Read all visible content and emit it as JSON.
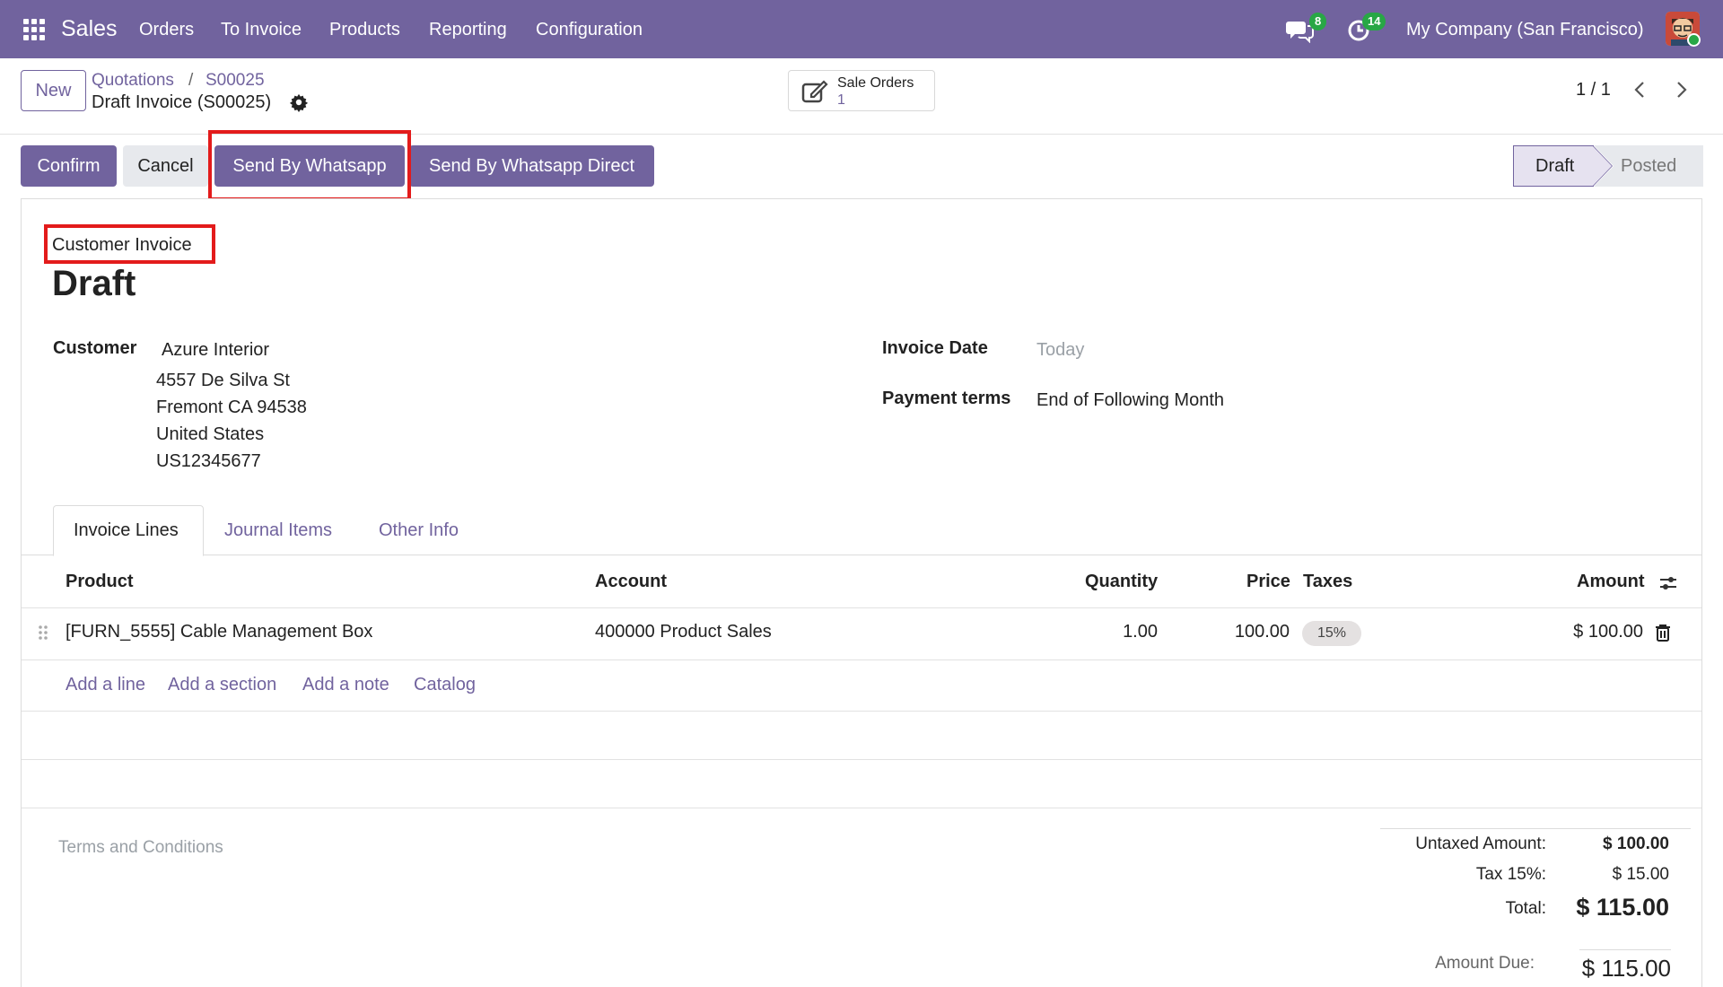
{
  "navbar": {
    "app_name": "Sales",
    "menus": [
      "Orders",
      "To Invoice",
      "Products",
      "Reporting",
      "Configuration"
    ],
    "messages_count": "8",
    "activities_count": "14",
    "company": "My Company (San Francisco)"
  },
  "control_panel": {
    "new_label": "New",
    "breadcrumb_parent": "Quotations",
    "breadcrumb_sep": "/",
    "breadcrumb_order": "S00025",
    "current_record": "Draft Invoice (S00025)",
    "smart_button_label": "Sale Orders",
    "smart_button_value": "1",
    "pager": "1 / 1"
  },
  "actions": {
    "confirm": "Confirm",
    "cancel": "Cancel",
    "send_whatsapp": "Send By Whatsapp",
    "send_whatsapp_direct": "Send By Whatsapp Direct"
  },
  "status": {
    "stages": [
      "Draft",
      "Posted"
    ],
    "current": "Draft"
  },
  "form": {
    "move_type": "Customer Invoice",
    "title": "Draft",
    "customer_label": "Customer",
    "customer_name": "Azure Interior",
    "customer_address": [
      "4557 De Silva St",
      "Fremont CA 94538",
      "United States",
      "US12345677"
    ],
    "invoice_date_label": "Invoice Date",
    "invoice_date_placeholder": "Today",
    "payment_terms_label": "Payment terms",
    "payment_terms_value": "End of Following Month"
  },
  "tabs": [
    "Invoice Lines",
    "Journal Items",
    "Other Info"
  ],
  "lines": {
    "headers": {
      "product": "Product",
      "account": "Account",
      "quantity": "Quantity",
      "price": "Price",
      "taxes": "Taxes",
      "amount": "Amount"
    },
    "rows": [
      {
        "product": "[FURN_5555] Cable Management Box",
        "account": "400000 Product Sales",
        "quantity": "1.00",
        "price": "100.00",
        "tax": "15%",
        "amount": "$ 100.00"
      }
    ],
    "add_links": [
      "Add a line",
      "Add a section",
      "Add a note",
      "Catalog"
    ]
  },
  "terms_placeholder": "Terms and Conditions",
  "totals": {
    "untaxed_label": "Untaxed Amount:",
    "untaxed_value": "$ 100.00",
    "tax_label": "Tax 15%:",
    "tax_value": "$ 15.00",
    "total_label": "Total:",
    "total_value": "$ 115.00",
    "due_label": "Amount Due:",
    "due_value": "$ 115.00"
  },
  "colors": {
    "brand": "#71639e",
    "badge": "#28a745",
    "highlight": "#e31b1b"
  }
}
